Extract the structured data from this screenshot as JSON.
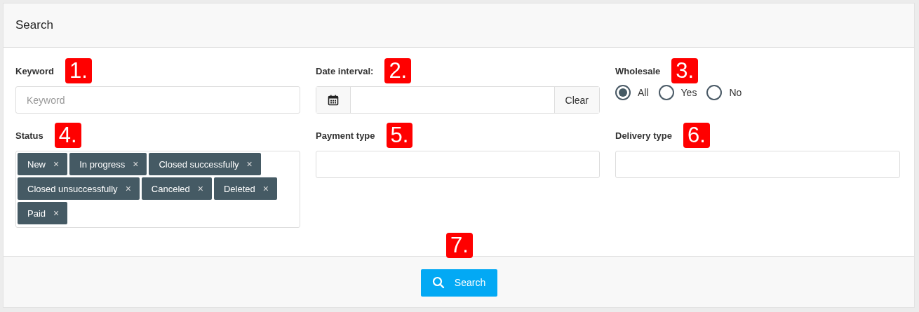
{
  "panel": {
    "title": "Search"
  },
  "fields": [
    {
      "kind": "text",
      "label": "Keyword",
      "marker": "1.",
      "placeholder": "Keyword"
    },
    {
      "kind": "date",
      "label": "Date interval:",
      "marker": "2.",
      "clear": "Clear"
    },
    {
      "kind": "radio",
      "label": "Wholesale",
      "marker": "3.",
      "options": [
        {
          "label": "All",
          "selected": true
        },
        {
          "label": "Yes",
          "selected": false
        },
        {
          "label": "No",
          "selected": false
        }
      ]
    },
    {
      "kind": "tags",
      "label": "Status",
      "marker": "4.",
      "tags": [
        "New",
        "In progress",
        "Closed successfully",
        "Closed unsuccessfully",
        "Canceled",
        "Deleted",
        "Paid"
      ],
      "remove": "×"
    },
    {
      "kind": "select",
      "label": "Payment type",
      "marker": "5."
    },
    {
      "kind": "select",
      "label": "Delivery type",
      "marker": "6."
    }
  ],
  "footer": {
    "marker": "7.",
    "button": "Search"
  }
}
